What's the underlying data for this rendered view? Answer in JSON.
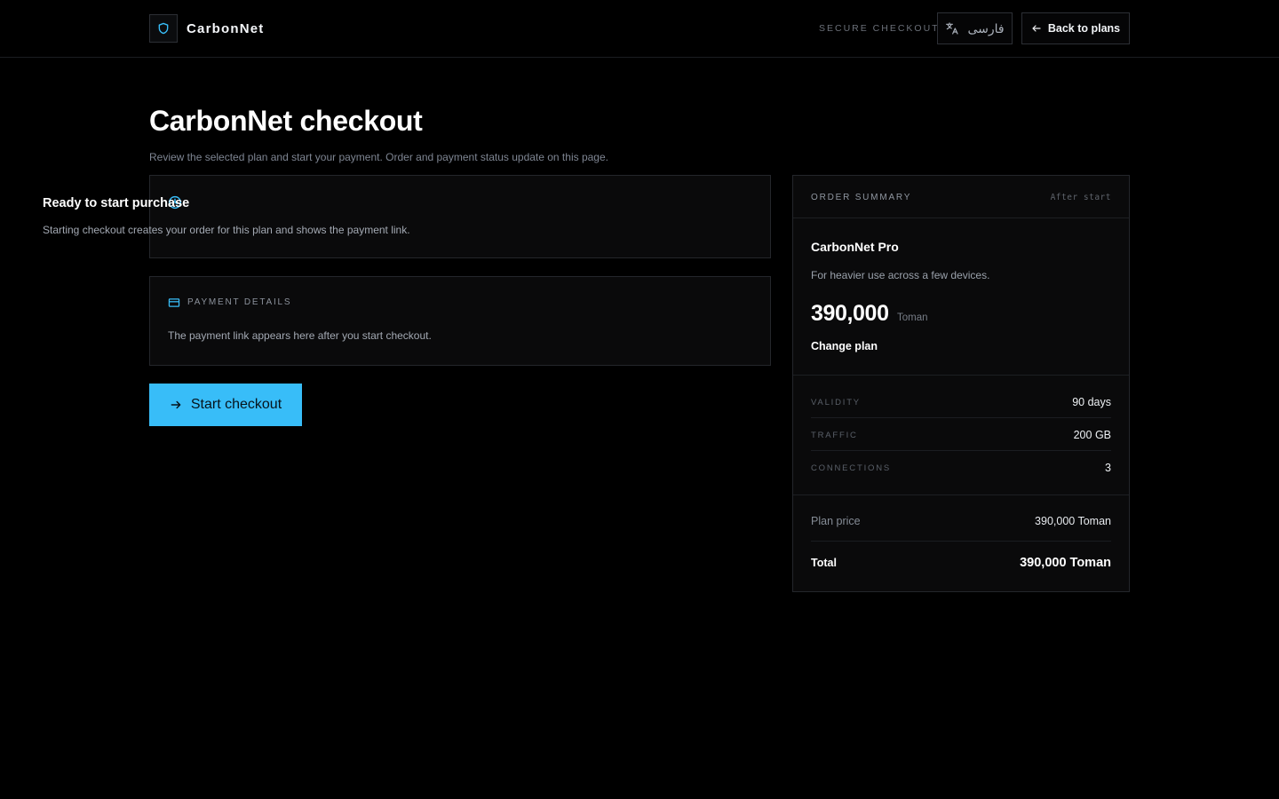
{
  "header": {
    "brand": "CarbonNet",
    "brand_icon": "shield-icon",
    "secure_label": "SECURE CHECKOUT",
    "language_button": "فارسی",
    "language_icon": "translate-icon",
    "back_button": "Back to plans",
    "back_icon": "arrow-left-icon"
  },
  "page": {
    "title": "CarbonNet checkout",
    "subtitle": "Review the selected plan and start your payment. Order and payment status update on this page."
  },
  "status_card": {
    "icon": "clock-icon",
    "title": "Ready to start purchase",
    "text": "Starting checkout creates your order for this plan and shows the payment link."
  },
  "payment_card": {
    "icon": "credit-card-icon",
    "label": "PAYMENT DETAILS",
    "text": "The payment link appears here after you start checkout."
  },
  "start_button": {
    "label": "Start checkout",
    "icon": "arrow-right-icon"
  },
  "summary": {
    "label": "ORDER SUMMARY",
    "after_label": "After start",
    "plan_name": "CarbonNet Pro",
    "plan_desc": "For heavier use across a few devices.",
    "price": "390,000",
    "currency": "Toman",
    "change_plan": "Change plan",
    "specs": [
      {
        "label": "VALIDITY",
        "value": "90 days"
      },
      {
        "label": "TRAFFIC",
        "value": "200 GB"
      },
      {
        "label": "CONNECTIONS",
        "value": "3"
      }
    ],
    "plan_price_label": "Plan price",
    "plan_price_value": "390,000 Toman",
    "total_label": "Total",
    "total_value": "390,000 Toman"
  },
  "colors": {
    "background": "#000000",
    "accent": "#38bdf8",
    "border": "#24262b",
    "card": "#0a0a0b"
  }
}
